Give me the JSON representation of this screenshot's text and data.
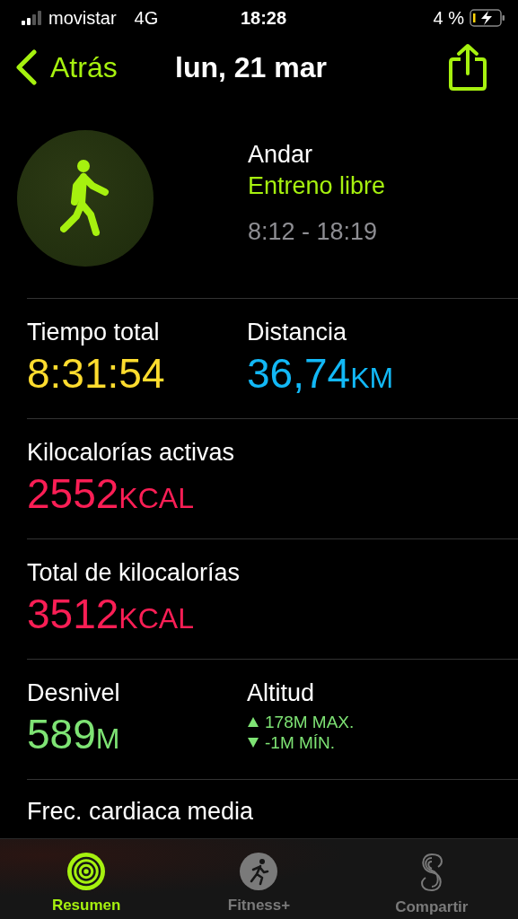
{
  "status_bar": {
    "carrier": "movistar",
    "network": "4G",
    "time": "18:28",
    "battery": "4 %"
  },
  "nav": {
    "back": "Atrás",
    "title": "lun, 21 mar"
  },
  "workout": {
    "type": "Andar",
    "subtitle": "Entreno libre",
    "time_range": "8:12 - 18:19"
  },
  "metric_rows": [
    {
      "cells": [
        {
          "kind": "value",
          "label": "Tiempo total",
          "value": "8:31:54",
          "color": "#fedc2e"
        },
        {
          "kind": "value",
          "label": "Distancia",
          "value": "36,74",
          "unit": "KM",
          "color": "#12b8f6"
        }
      ]
    },
    {
      "cells": [
        {
          "kind": "value",
          "label": "Kilocalorías activas",
          "value": "2552",
          "unit": "KCAL",
          "color": "#fa1e55"
        }
      ]
    },
    {
      "cells": [
        {
          "kind": "value",
          "label": "Total de kilocalorías",
          "value": "3512",
          "unit": "KCAL",
          "color": "#fa1e55"
        }
      ]
    },
    {
      "cells": [
        {
          "kind": "value",
          "label": "Desnivel",
          "value": "589",
          "unit": "M",
          "color": "#7ee374"
        },
        {
          "kind": "range",
          "label": "Altitud",
          "color": "#7ee374",
          "lines": [
            {
              "kind": "up",
              "text": "178M MAX."
            },
            {
              "kind": "down",
              "text": "-1M MÍN."
            }
          ]
        }
      ]
    },
    {
      "cells": [
        {
          "kind": "label",
          "label": "Frec. cardiaca media"
        }
      ]
    }
  ],
  "tabs": [
    {
      "label": "Resumen",
      "selected": true
    },
    {
      "label": "Fitness+",
      "selected": false
    },
    {
      "label": "Compartir",
      "selected": false
    }
  ]
}
